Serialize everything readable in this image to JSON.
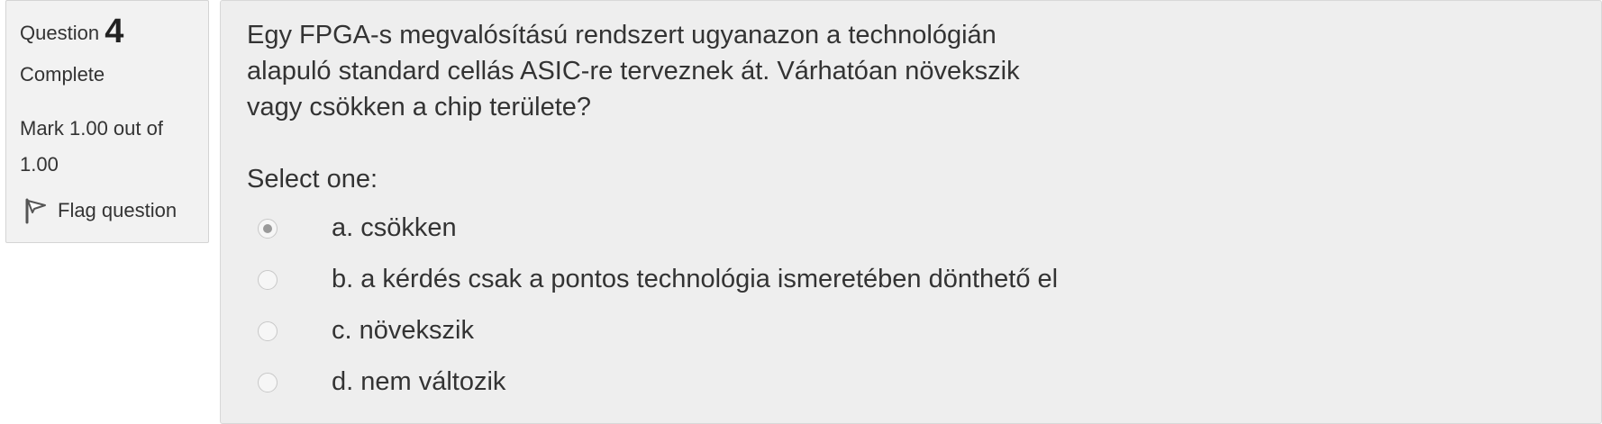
{
  "info": {
    "question_label": "Question",
    "question_number": "4",
    "state": "Complete",
    "grade": "Mark 1.00 out of 1.00",
    "flag_label": "Flag question"
  },
  "question": {
    "text": "Egy FPGA-s megvalósítású rendszert ugyanazon a technológián alapuló standard cellás ASIC-re terveznek át. Várhatóan növekszik vagy csökken a chip területe?",
    "prompt": "Select one:",
    "options": [
      {
        "label": "a. csökken",
        "checked": true
      },
      {
        "label": "b. a kérdés csak a pontos technológia ismeretében dönthető el",
        "checked": false
      },
      {
        "label": "c. növekszik",
        "checked": false
      },
      {
        "label": "d. nem változik",
        "checked": false
      }
    ]
  },
  "colors": {
    "panel_bg": "#eeeeee",
    "info_bg": "#f2f2f2",
    "text": "#333333"
  },
  "icons": {
    "flag": "flag-icon"
  }
}
